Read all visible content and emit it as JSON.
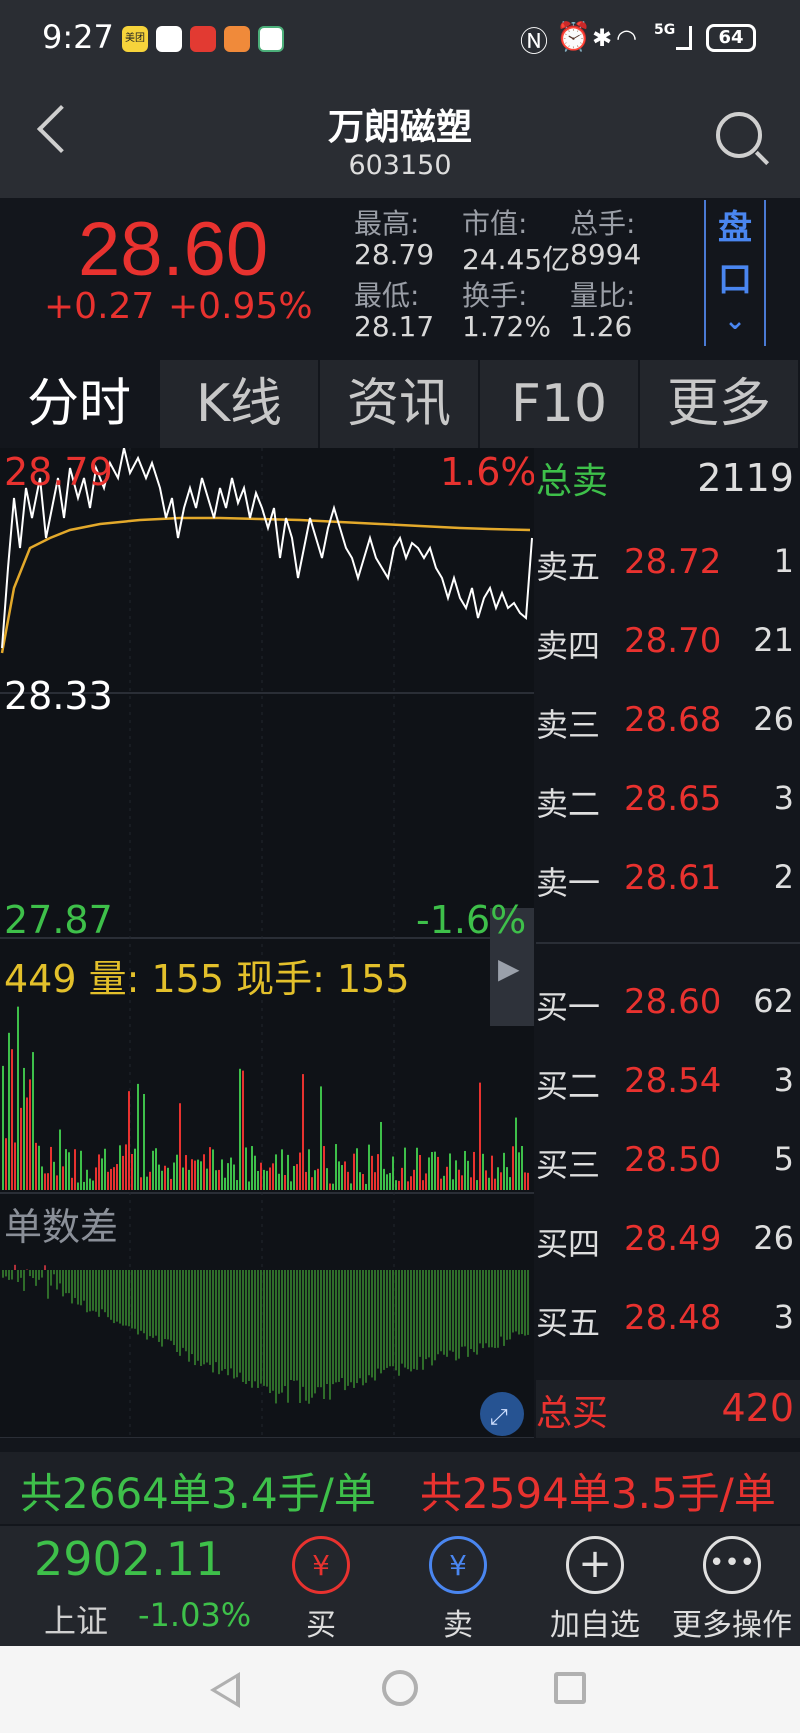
{
  "status_bar": {
    "time": "9:27",
    "apps": [
      "美团",
      "QQ",
      "红",
      "橙",
      "绿"
    ],
    "battery": "64",
    "network": "5G"
  },
  "header": {
    "name": "万朗磁塑",
    "code": "603150"
  },
  "quote": {
    "price": "28.60",
    "change": "+0.27",
    "change_pct": "+0.95%",
    "high_label": "最高:",
    "high": "28.79",
    "mcap_label": "市值:",
    "mcap": "24.45亿",
    "total_label": "总手:",
    "total": "8994",
    "low_label": "最低:",
    "low": "28.17",
    "turnover_label": "换手:",
    "turnover": "1.72%",
    "volratio_label": "量比:",
    "volratio": "1.26",
    "pankou": [
      "盘",
      "口"
    ]
  },
  "tabs": [
    "分时",
    "K线",
    "资讯",
    "F10",
    "更多"
  ],
  "chart": {
    "top_price": "28.79",
    "top_pct": "1.6%",
    "mid_price": "28.33",
    "bottom_price": "27.87",
    "bottom_pct": "-1.6%",
    "volume_line": "449 量: 155 现手: 155",
    "indicator": "单数差"
  },
  "orderbook": {
    "sell_total_label": "总卖",
    "sell_total": "2119",
    "sells": [
      {
        "name": "卖五",
        "price": "28.72",
        "vol": "1"
      },
      {
        "name": "卖四",
        "price": "28.70",
        "vol": "21"
      },
      {
        "name": "卖三",
        "price": "28.68",
        "vol": "26"
      },
      {
        "name": "卖二",
        "price": "28.65",
        "vol": "3"
      },
      {
        "name": "卖一",
        "price": "28.61",
        "vol": "2"
      }
    ],
    "buys": [
      {
        "name": "买一",
        "price": "28.60",
        "vol": "62"
      },
      {
        "name": "买二",
        "price": "28.54",
        "vol": "3"
      },
      {
        "name": "买三",
        "price": "28.50",
        "vol": "5"
      },
      {
        "name": "买四",
        "price": "28.49",
        "vol": "26"
      },
      {
        "name": "买五",
        "price": "28.48",
        "vol": "3"
      }
    ],
    "buy_total_label": "总买",
    "buy_total": "420"
  },
  "summary": {
    "sell_text": "共2664单3.4手/单",
    "buy_text": "共2594单3.5手/单"
  },
  "toolbar": {
    "index_value": "2902.11",
    "index_name": "上证",
    "index_change": "-1.03%",
    "buy_label": "买",
    "sell_label": "卖",
    "add_label": "加自选",
    "more_label": "更多操作"
  },
  "colors": {
    "up": "#e8322f",
    "down": "#3ec04a",
    "avg_line": "#e3a92b",
    "price_line": "#ffffff",
    "accent": "#4a86f0"
  }
}
